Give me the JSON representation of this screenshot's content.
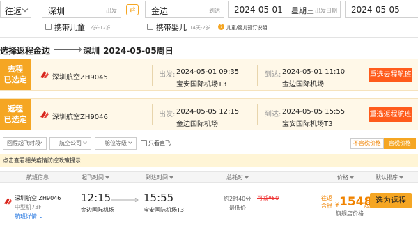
{
  "search": {
    "trip_type": "往返",
    "from_city": "深圳",
    "from_tag": "出发",
    "to_city": "金边",
    "to_tag": "到达",
    "depart_date": "2024-05-01",
    "depart_weekday": "星期三",
    "depart_tag": "出发日期",
    "return_date": "2024-05-05"
  },
  "passengers": {
    "child_label": "携带儿童",
    "child_hint": "2岁-12岁",
    "infant_label": "携带婴儿",
    "infant_hint": "14天-2岁",
    "booking_info": "儿童/婴儿预订说明"
  },
  "route": {
    "prefix": "选择返程:",
    "from": "金边",
    "to": "深圳",
    "date": "2024-05-05周日"
  },
  "outbound": {
    "tag_top": "去程",
    "tag_bottom": "已选定",
    "airline": "深圳航空ZH9045",
    "depart_label": "出发:",
    "depart_time": "2024-05-01 09:35",
    "depart_airport": "宝安国际机场T3",
    "arrive_label": "到达:",
    "arrive_time": "2024-05-01 11:10",
    "arrive_airport": "金边国际机场",
    "reselect": "重选去程航班"
  },
  "return_flight": {
    "tag_top": "返程",
    "tag_bottom": "已选定",
    "airline": "深圳航空ZH9046",
    "depart_label": "出发:",
    "depart_time": "2024-05-05 12:15",
    "depart_airport": "金边国际机场",
    "arrive_label": "到达:",
    "arrive_time": "2024-05-05 15:55",
    "arrive_airport": "宝安国际机场T3",
    "reselect": "重选返程航班"
  },
  "filters": {
    "dep_time": "回程起飞时段",
    "airline": "航空公司",
    "cabin": "舱位等级",
    "direct_only": "只看直飞",
    "tax_excluded": "不含税价格",
    "tax_included": "含税价格"
  },
  "notice": "点击查看相关疫情防控政策提示",
  "columns": {
    "info": "航班信息",
    "depart": "起飞时间",
    "arrive": "到达时间",
    "duration": "总耗时",
    "price": "价格",
    "sort": "默认排序"
  },
  "result": {
    "airline": "深圳航空 ZH9046",
    "aircraft": "中型机73F",
    "details": "航班详情",
    "depart_time": "12:15",
    "depart_airport": "金边国际机场",
    "arrive_time": "15:55",
    "arrive_airport": "宝安国际机场T3",
    "duration": "约2时40分",
    "lowest": "最低价",
    "discount": "可减¥50",
    "return_label": "往返",
    "tax_label": "含税",
    "currency": "¥",
    "price": "1548",
    "price_suffix": "起",
    "store": "旗舰店价格",
    "select": "选为返程"
  },
  "colors": {
    "accent": "#f5a623",
    "cta": "#ff5b1b",
    "price": "#f08300"
  },
  "icons": {
    "logo": "shenzhen-airlines-logo-icon",
    "swap": "swap-icon"
  }
}
